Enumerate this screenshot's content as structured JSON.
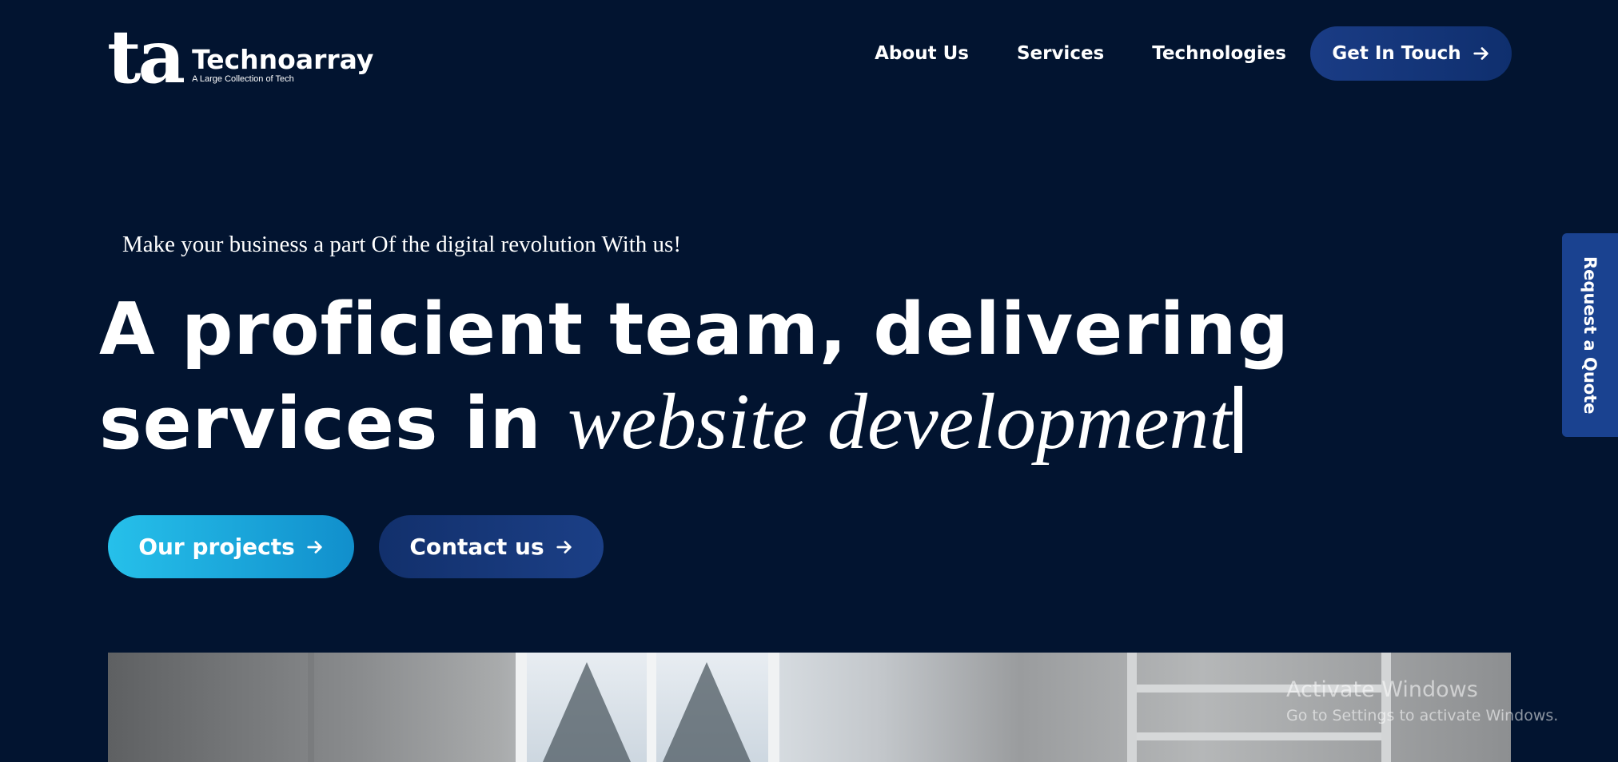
{
  "brand": {
    "logo_mark": "ta",
    "name": "Technoarray",
    "tagline": "A Large Collection of Tech"
  },
  "nav": {
    "items": [
      {
        "label": "About Us"
      },
      {
        "label": "Services"
      },
      {
        "label": "Technologies"
      }
    ],
    "cta_label": "Get In Touch",
    "cta_icon": "arrow-right-icon"
  },
  "hero": {
    "eyebrow": "Make your business a part Of the digital revolution With us!",
    "headline_line1": "A proficient team, delivering",
    "headline_line2_prefix": "services in ",
    "headline_typed": "website development",
    "primary_button": "Our projects",
    "secondary_button": "Contact us"
  },
  "side_tab": {
    "label": "Request a Quote"
  },
  "watermark": {
    "title": "Activate Windows",
    "subtitle": "Go to Settings to activate Windows."
  },
  "colors": {
    "background": "#021430",
    "nav_cta": "#16377a",
    "primary_button": "#1fb4e3",
    "secondary_button": "#15356f",
    "side_tab": "#1a4290"
  }
}
